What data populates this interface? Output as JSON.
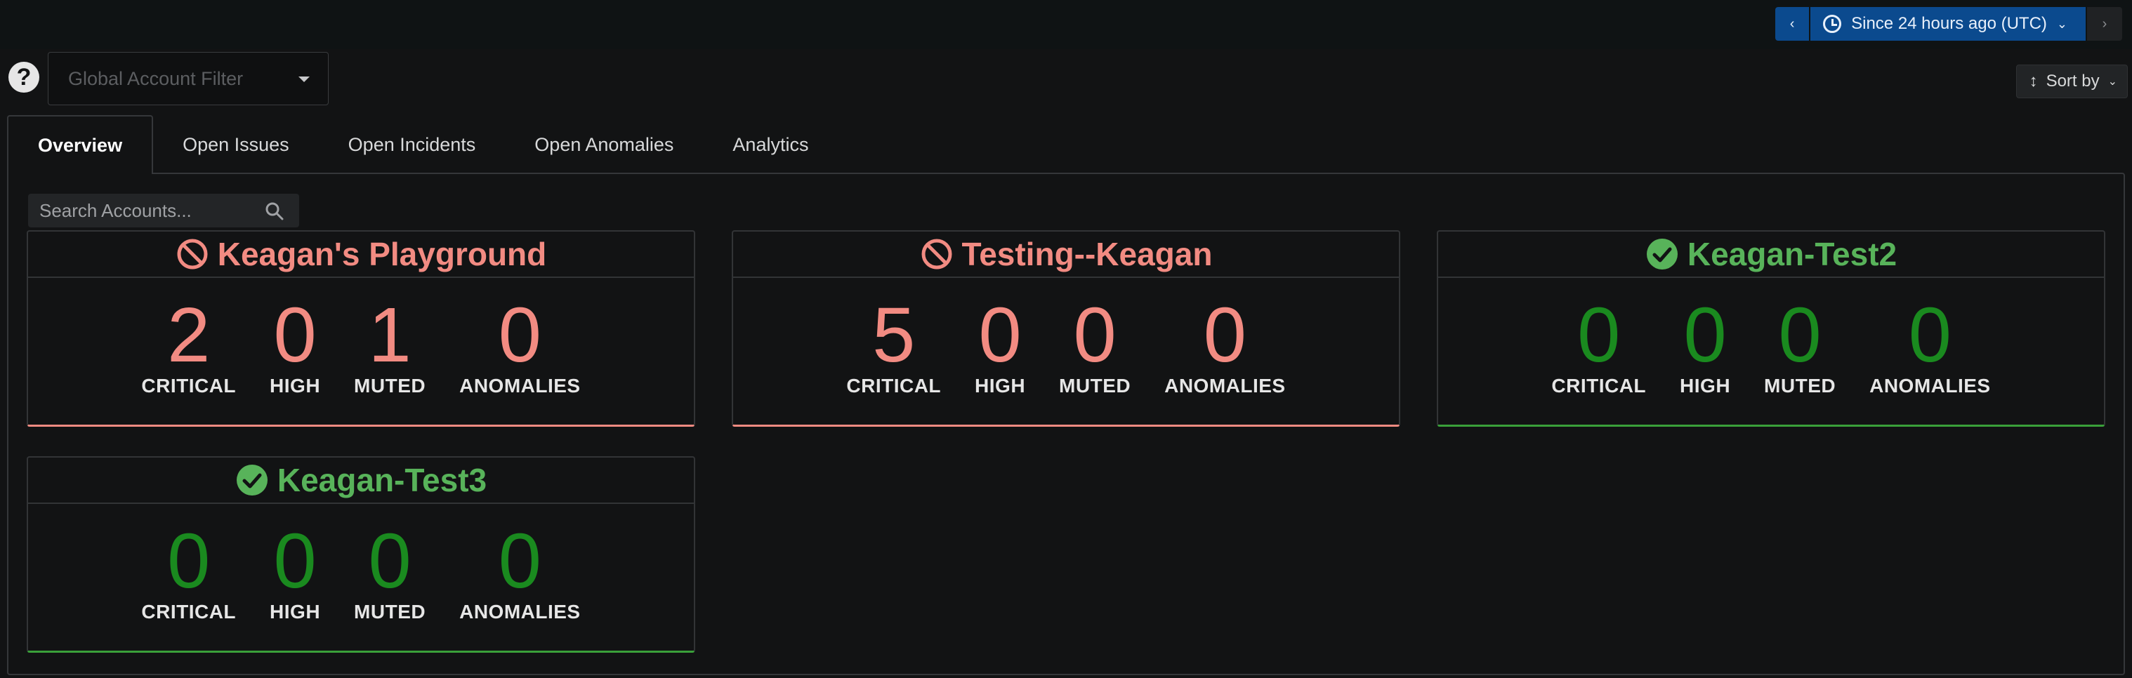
{
  "time_picker": {
    "label": "Since 24 hours ago (UTC)",
    "prev_icon": "chevron-left-icon",
    "next_icon": "chevron-right-icon"
  },
  "account_filter": {
    "placeholder": "Global Account Filter"
  },
  "sort": {
    "label": "Sort by"
  },
  "tabs": [
    {
      "label": "Overview",
      "active": true
    },
    {
      "label": "Open Issues"
    },
    {
      "label": "Open Incidents"
    },
    {
      "label": "Open Anomalies"
    },
    {
      "label": "Analytics"
    }
  ],
  "search": {
    "placeholder": "Search Accounts..."
  },
  "colors": {
    "bad": "#f28b82",
    "good_title": "#58b35a",
    "good_num": "#1a8a1f",
    "accent": "#0b4a8e"
  },
  "cards": [
    {
      "name": "Keagan's Playground",
      "status": "bad",
      "stats": [
        {
          "value": "2",
          "label": "CRITICAL"
        },
        {
          "value": "0",
          "label": "HIGH"
        },
        {
          "value": "1",
          "label": "MUTED"
        },
        {
          "value": "0",
          "label": "ANOMALIES"
        }
      ]
    },
    {
      "name": "Testing--Keagan",
      "status": "bad",
      "stats": [
        {
          "value": "5",
          "label": "CRITICAL"
        },
        {
          "value": "0",
          "label": "HIGH"
        },
        {
          "value": "0",
          "label": "MUTED"
        },
        {
          "value": "0",
          "label": "ANOMALIES"
        }
      ]
    },
    {
      "name": "Keagan-Test2",
      "status": "good",
      "stats": [
        {
          "value": "0",
          "label": "CRITICAL"
        },
        {
          "value": "0",
          "label": "HIGH"
        },
        {
          "value": "0",
          "label": "MUTED"
        },
        {
          "value": "0",
          "label": "ANOMALIES"
        }
      ]
    },
    {
      "name": "Keagan-Test3",
      "status": "good",
      "stats": [
        {
          "value": "0",
          "label": "CRITICAL"
        },
        {
          "value": "0",
          "label": "HIGH"
        },
        {
          "value": "0",
          "label": "MUTED"
        },
        {
          "value": "0",
          "label": "ANOMALIES"
        }
      ]
    }
  ]
}
